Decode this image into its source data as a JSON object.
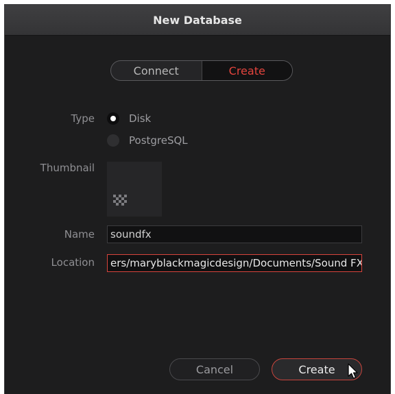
{
  "dialog": {
    "title": "New Database"
  },
  "mode_tabs": [
    {
      "label": "Connect",
      "active": false
    },
    {
      "label": "Create",
      "active": true
    }
  ],
  "type": {
    "label": "Type",
    "options": [
      {
        "label": "Disk",
        "selected": true
      },
      {
        "label": "PostgreSQL",
        "selected": false
      }
    ]
  },
  "thumbnail": {
    "label": "Thumbnail",
    "icon": "database-grid-icon"
  },
  "name": {
    "label": "Name",
    "value": "soundfx"
  },
  "location": {
    "label": "Location",
    "value": "ers/maryblackmagicdesign/Documents/Sound FX"
  },
  "buttons": {
    "cancel": "Cancel",
    "create": "Create"
  },
  "colors": {
    "accent": "#e3443d",
    "background": "#1d1d1e",
    "titlebar": "#3a3a3c"
  }
}
